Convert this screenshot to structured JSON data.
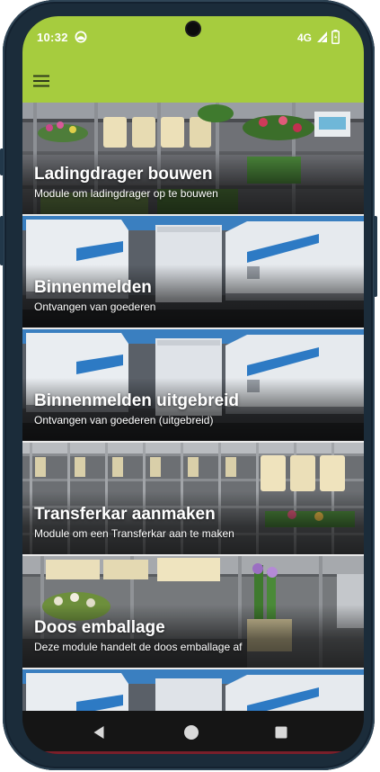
{
  "status_bar": {
    "time": "10:32",
    "network": "4G",
    "app_icon": "app-notification-icon",
    "signal_icon": "signal-icon",
    "battery_icon": "battery-icon"
  },
  "app_bar": {
    "menu_icon": "hamburger-menu-icon",
    "color": "#a6cc3e"
  },
  "modules": [
    {
      "title": "Ladingdrager bouwen",
      "subtitle": "Module om ladingdrager op te bouwen",
      "image": "flower-carts-greenhouse"
    },
    {
      "title": "Binnenmelden",
      "subtitle": "Ontvangen van goederen",
      "image": "trailers-at-dock"
    },
    {
      "title": "Binnenmelden uitgebreid",
      "subtitle": "Ontvangen van goederen (uitgebreid)",
      "image": "trailers-at-dock"
    },
    {
      "title": "Transferkar aanmaken",
      "subtitle": "Module om een Transferkar aan te maken",
      "image": "transfer-carts-rows"
    },
    {
      "title": "Doos emballage",
      "subtitle": "Deze module handelt de doos emballage af",
      "image": "flower-boxes-warehouse"
    }
  ],
  "nav_bar": {
    "back_icon": "back-triangle-icon",
    "home_icon": "home-circle-icon",
    "recents_icon": "recents-square-icon"
  }
}
